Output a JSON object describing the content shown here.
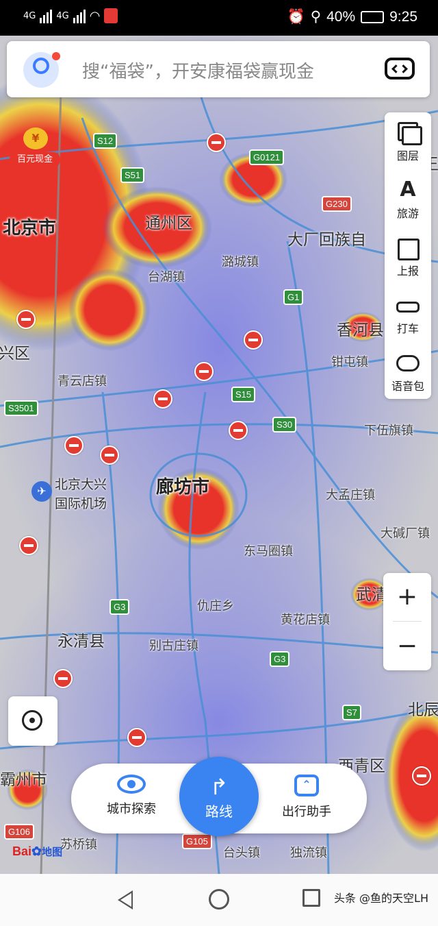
{
  "status": {
    "signal1": "4G",
    "signal2": "4G",
    "battery": "40%",
    "time": "9:25"
  },
  "search": {
    "placeholder": "搜“福袋”，开安康福袋赢现金"
  },
  "promo": {
    "label": "百元现金",
    "coin": "¥"
  },
  "sidebar": {
    "items": [
      {
        "label": "图层",
        "icon": "layers-icon"
      },
      {
        "label": "旅游",
        "icon": "travel-icon"
      },
      {
        "label": "上报",
        "icon": "report-icon"
      },
      {
        "label": "打车",
        "icon": "taxi-icon"
      },
      {
        "label": "语音包",
        "icon": "voice-pack-icon"
      }
    ]
  },
  "zoom": {
    "plus": "+",
    "minus": "−"
  },
  "map": {
    "cities": [
      "北京市",
      "廊坊市",
      "通州区",
      "大厂回族自",
      "香河县",
      "永清县",
      "霸州市",
      "西青区",
      "北京大兴",
      "国际机场",
      "武清",
      "北辰",
      "王",
      "兴区"
    ],
    "towns": [
      "台湖镇",
      "潞城镇",
      "钳屯镇",
      "青云店镇",
      "下伍旗镇",
      "大孟庄镇",
      "大碱厂镇",
      "东马圈镇",
      "仇庄乡",
      "黄花店镇",
      "别古庄镇",
      "苏桥镇",
      "台头镇",
      "独流镇"
    ],
    "shields": {
      "s12": "S12",
      "s51": "S51",
      "g0121": "G0121",
      "g230": "G230",
      "g1": "G1",
      "s15": "S15",
      "s30": "S30",
      "s3501": "S3501",
      "g3a": "G3",
      "g3b": "G3",
      "s7": "S7",
      "g106": "G106",
      "g105": "G105"
    },
    "colors": {
      "heat_high": "#e8332b",
      "heat_mid": "#f0d23a",
      "heat_low": "#3e5ce0",
      "road": "#4a8fd6"
    }
  },
  "bottom": {
    "explore_label": "城市探索",
    "route_label": "路线",
    "assistant_label": "出行助手"
  },
  "logo": {
    "text": "Bai",
    "suffix": "地图"
  },
  "watermark": "头条 @鱼的天空LH"
}
